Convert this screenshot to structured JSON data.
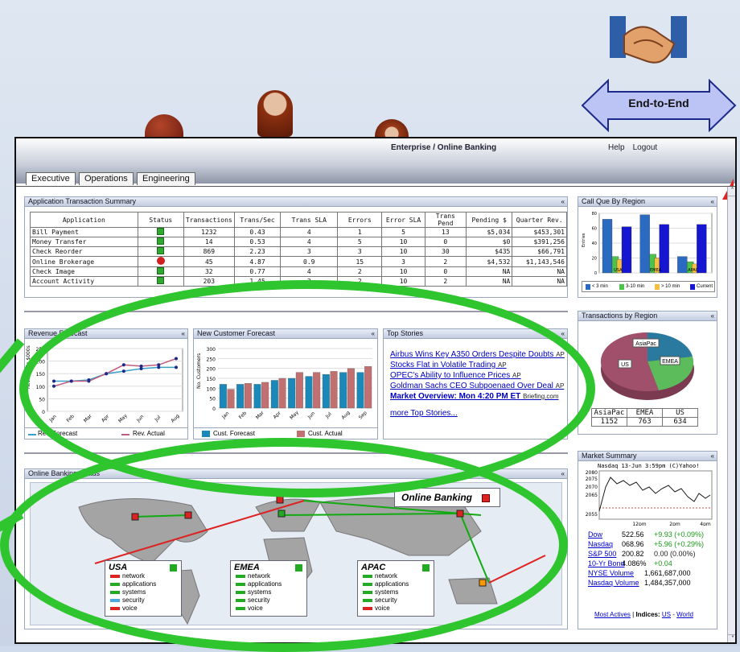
{
  "header": {
    "enterprise_title": "Enterprise / Online Banking",
    "help": "Help",
    "logout": "Logout"
  },
  "badge": {
    "label": "End-to-End"
  },
  "tabs": [
    "Executive",
    "Operations",
    "Engineering"
  ],
  "ats": {
    "title": "Application Transaction Summary",
    "columns": [
      "Application",
      "Status",
      "Transactions",
      "Trans/Sec",
      "Trans SLA",
      "Errors",
      "Error SLA",
      "Trans Pend",
      "Pending $",
      "Quarter Rev."
    ],
    "rows": [
      [
        "Bill Payment",
        "green",
        "1232",
        "0.43",
        "4",
        "1",
        "5",
        "13",
        "$5,034",
        "$453,301"
      ],
      [
        "Money Transfer",
        "green",
        "14",
        "0.53",
        "4",
        "5",
        "10",
        "0",
        "$0",
        "$391,256"
      ],
      [
        "Check Reorder",
        "green",
        "869",
        "2.23",
        "3",
        "3",
        "10",
        "30",
        "$435",
        "$66,791"
      ],
      [
        "Online Brokerage",
        "red",
        "45",
        "4.87",
        "0.9",
        "15",
        "3",
        "2",
        "$4,532",
        "$1,143,546"
      ],
      [
        "Check Image",
        "green",
        "32",
        "0.77",
        "4",
        "2",
        "10",
        "0",
        "NA",
        "NA"
      ],
      [
        "Account Activity",
        "green",
        "203",
        "1.45",
        "2",
        "2",
        "10",
        "2",
        "NA",
        "NA"
      ]
    ]
  },
  "callque": {
    "title": "Call Que By Region",
    "ylabel": "Entries",
    "regions": [
      "USA",
      "EMEA",
      "APAC"
    ],
    "legend": [
      "< 3 min",
      "3-10 min",
      "> 10 min",
      "Current"
    ]
  },
  "tbr": {
    "title": "Transactions by Region",
    "labels": [
      "AsiaPac",
      "EMEA",
      "US"
    ],
    "values": [
      "1152",
      "763",
      "634"
    ]
  },
  "revenue": {
    "title": "Revenue Forecast",
    "ylabel": "Revenue in $000s",
    "legend": [
      "Rev. Forecast",
      "Rev. Actual"
    ]
  },
  "ncf": {
    "title": "New Customer Forecast",
    "ylabel": "No. Customers",
    "legend": [
      "Cust. Forecast",
      "Cust. Actual"
    ]
  },
  "stories": {
    "title": "Top Stories",
    "items": [
      {
        "t": "Airbus Wins Key A350 Orders Despite Doubts",
        "s": "AP"
      },
      {
        "t": "Stocks Flat in Volatile Trading",
        "s": "AP"
      },
      {
        "t": "OPEC's Ability to Influence Prices",
        "s": "AP"
      },
      {
        "t": "Goldman Sachs CEO Subpoenaed Over Deal",
        "s": "AP"
      }
    ],
    "market": "Market Overview:  Mon 4:20 PM ET",
    "market_src": "Briefing.com",
    "more": "more Top Stories..."
  },
  "market": {
    "title": "Market Summary",
    "chart_title": "Nasdaq 13-Jun 3:59pm (C)Yahoo!",
    "xticks": [
      "12pm",
      "2pm",
      "4pm"
    ],
    "yticks": [
      "2080",
      "2075",
      "2070",
      "2065",
      "2055"
    ],
    "rows": [
      [
        "Dow",
        "522.56",
        "+9.93 (+0.09%)"
      ],
      [
        "Nasdaq",
        "068.96",
        "+5.96 (+0.29%)"
      ],
      [
        "S&P 500",
        "200.82",
        "0.00  (0.00%)"
      ],
      [
        "10-Yr Bond",
        "4.086%",
        "+0.04"
      ],
      [
        "NYSE Volume",
        "1,661,687,000",
        ""
      ],
      [
        "Nasdaq Volume",
        "1,484,357,000",
        ""
      ]
    ],
    "actives": "Most Actives",
    "indices": "Indices:",
    "us": "US",
    "world": "World"
  },
  "obs": {
    "title": "Online Banking Status",
    "map_label": "Online Banking",
    "regions": [
      "USA",
      "EMEA",
      "APAC"
    ],
    "items": [
      "network",
      "applications",
      "systems",
      "security",
      "voice"
    ]
  },
  "chart_data": [
    {
      "type": "line",
      "title": "Revenue Forecast",
      "x": [
        "Jan",
        "Feb",
        "Mar",
        "Apr",
        "May",
        "Jun",
        "Jul",
        "Aug"
      ],
      "ylim": [
        0,
        250
      ],
      "series": [
        {
          "name": "Rev. Forecast",
          "values": [
            120,
            120,
            125,
            150,
            160,
            170,
            175,
            175
          ]
        },
        {
          "name": "Rev. Actual",
          "values": [
            100,
            120,
            120,
            150,
            185,
            180,
            185,
            210
          ]
        }
      ]
    },
    {
      "type": "bar",
      "title": "New Customer Forecast",
      "x": [
        "Jan",
        "Feb",
        "Mar",
        "Apr",
        "May",
        "Jun",
        "Jul",
        "Aug",
        "Sep"
      ],
      "ylim": [
        0,
        300
      ],
      "series": [
        {
          "name": "Cust. Forecast",
          "values": [
            120,
            120,
            120,
            140,
            150,
            160,
            170,
            180,
            180
          ]
        },
        {
          "name": "Cust. Actual",
          "values": [
            95,
            125,
            130,
            150,
            180,
            180,
            185,
            200,
            210
          ]
        }
      ]
    },
    {
      "type": "bar",
      "title": "Call Que By Region",
      "categories": [
        "USA",
        "EMEA",
        "APAC"
      ],
      "ylim": [
        0,
        80
      ],
      "series": [
        {
          "name": "< 3 min",
          "values": [
            72,
            78,
            22
          ]
        },
        {
          "name": "3-10 min",
          "values": [
            22,
            25,
            15
          ]
        },
        {
          "name": "> 10 min",
          "values": [
            18,
            20,
            12
          ]
        },
        {
          "name": "Current",
          "values": [
            62,
            65,
            65
          ]
        }
      ]
    },
    {
      "type": "pie",
      "title": "Transactions by Region",
      "categories": [
        "AsiaPac",
        "EMEA",
        "US"
      ],
      "values": [
        1152,
        763,
        634
      ]
    }
  ]
}
